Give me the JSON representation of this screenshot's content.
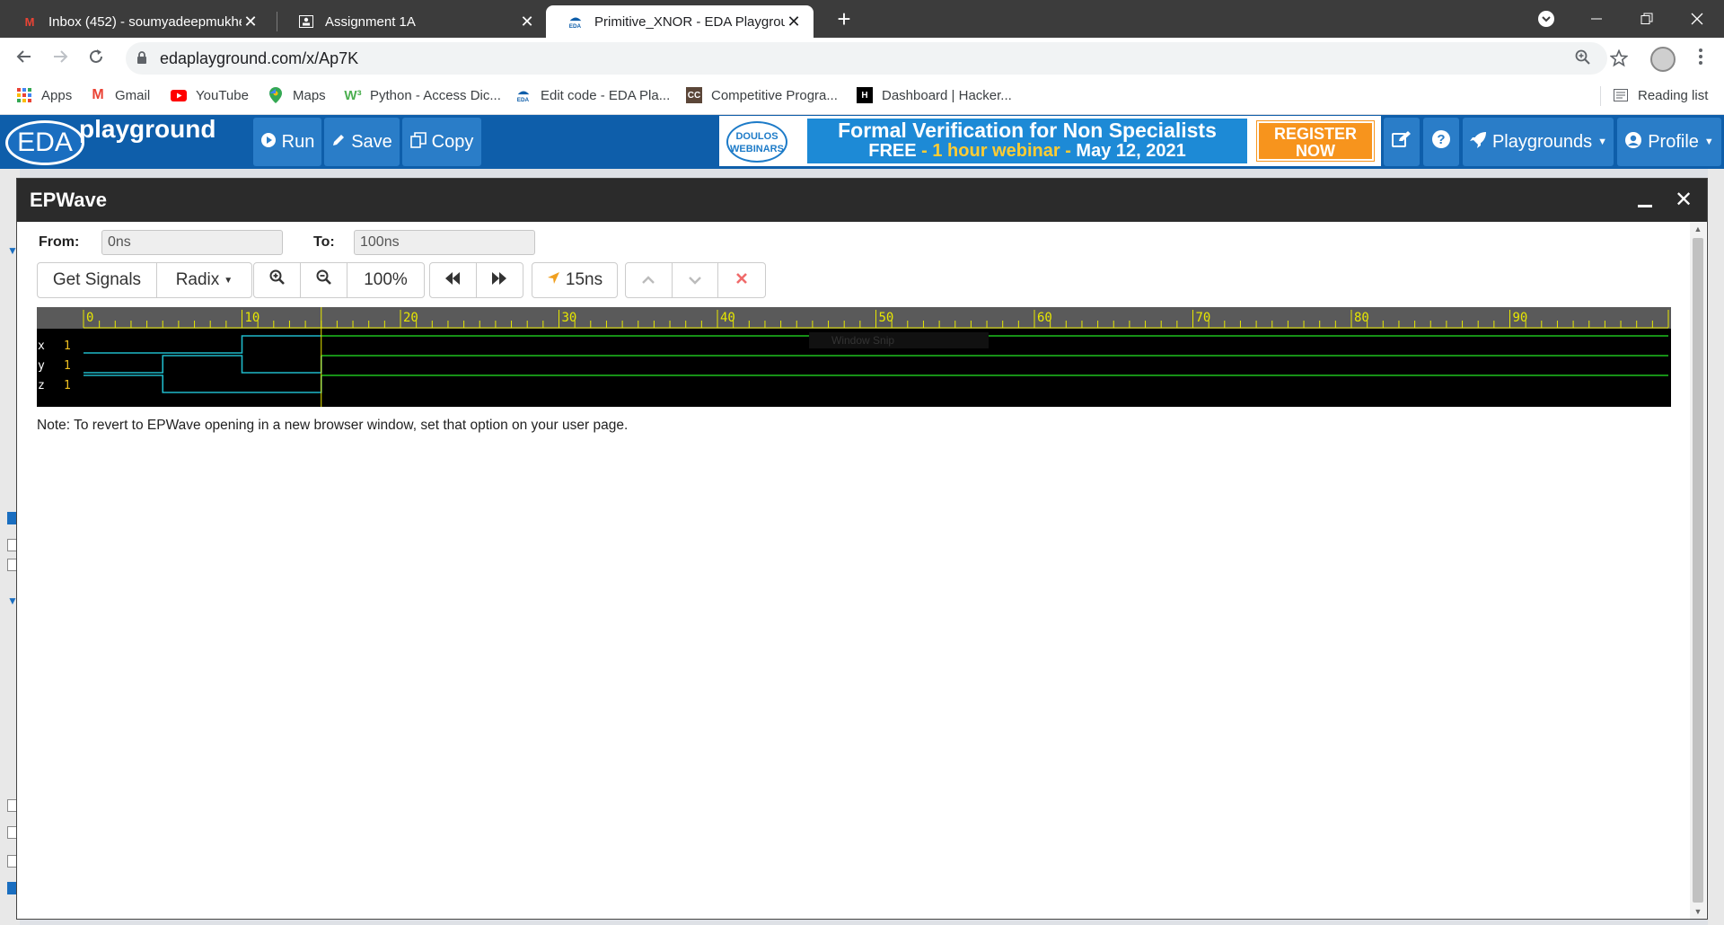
{
  "browser": {
    "tabs": [
      {
        "title": "Inbox (452) - soumyadeepmukhe",
        "icon": "gmail-icon",
        "active": false
      },
      {
        "title": "Assignment 1A",
        "icon": "classroom-icon",
        "active": false
      },
      {
        "title": "Primitive_XNOR - EDA Playgroun",
        "icon": "eda-icon",
        "active": true
      }
    ],
    "close_glyph": "✕",
    "new_tab_glyph": "+",
    "url": "edaplayground.com/x/Ap7K",
    "bookmarks": [
      {
        "label": "Apps",
        "icon": "apps-grid-icon"
      },
      {
        "label": "Gmail",
        "icon": "gmail-icon"
      },
      {
        "label": "YouTube",
        "icon": "youtube-icon"
      },
      {
        "label": "Maps",
        "icon": "maps-icon"
      },
      {
        "label": "Python - Access Dic...",
        "icon": "w3schools-icon"
      },
      {
        "label": "Edit code - EDA Pla...",
        "icon": "eda-icon"
      },
      {
        "label": "Competitive Progra...",
        "icon": "cc-icon"
      },
      {
        "label": "Dashboard | Hacker...",
        "icon": "hackerrank-icon"
      }
    ],
    "reading_list": "Reading list"
  },
  "eda": {
    "logo_eda": "EDA",
    "logo_playground": "playground",
    "run": "Run",
    "save": "Save",
    "copy": "Copy",
    "banner": {
      "doulos": "DOULOS WEBINARS",
      "line1": "Formal Verification for Non Specialists",
      "line2_free": "FREE",
      "line2_mid": "1 hour webinar",
      "line2_date": "May 12, 2021",
      "register_1": "REGISTER",
      "register_2": "NOW"
    },
    "playgrounds": "Playgrounds",
    "profile": "Profile"
  },
  "epwave": {
    "title": "EPWave",
    "from_label": "From:",
    "from_value": "0ns",
    "to_label": "To:",
    "to_value": "100ns",
    "get_signals": "Get Signals",
    "radix": "Radix",
    "zoom_level": "100%",
    "cursor_time": "15ns",
    "note": "Note: To revert to EPWave opening in a new browser window, set that option on your user page.",
    "overlay_text": "Window Snip",
    "colors": {
      "ruler_bg": "#5a5a5a",
      "ruler_tick": "#e8e800",
      "wave_teal": "#1fb8c8",
      "wave_green": "#1dc01d",
      "value_yellow": "#f0c020",
      "cursor": "#e8e800"
    }
  },
  "chart_data": {
    "type": "waveform",
    "time_unit": "ns",
    "xlim": [
      0,
      100
    ],
    "ruler_labels": [
      "0",
      "10",
      "20",
      "30",
      "40",
      "50",
      "60",
      "70",
      "80",
      "90"
    ],
    "cursor": 15,
    "signals": [
      {
        "name": "x",
        "value_at_cursor": "1",
        "transitions": [
          [
            0,
            0
          ],
          [
            10,
            1
          ]
        ]
      },
      {
        "name": "y",
        "value_at_cursor": "1",
        "transitions": [
          [
            0,
            0
          ],
          [
            5,
            1
          ],
          [
            10,
            0
          ],
          [
            15,
            1
          ]
        ]
      },
      {
        "name": "z",
        "value_at_cursor": "1",
        "transitions": [
          [
            0,
            1
          ],
          [
            5,
            0
          ],
          [
            15,
            1
          ]
        ]
      }
    ]
  }
}
